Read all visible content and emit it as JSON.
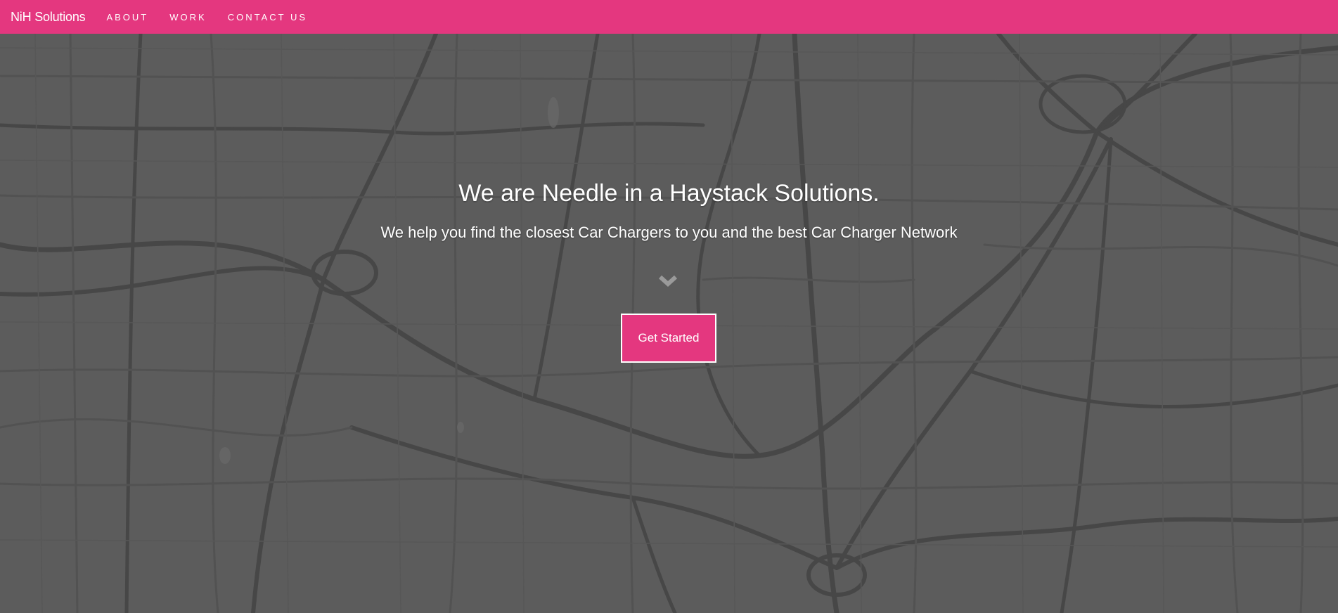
{
  "navbar": {
    "brand": "NiH Solutions",
    "links": [
      "ABOUT",
      "WORK",
      "CONTACT US"
    ],
    "background_color": "#e4377f"
  },
  "hero": {
    "title": "We are Needle in a Haystack Solutions.",
    "subtitle": "We help you find the closest Car Chargers to you and the best Car Charger Network",
    "scroll_icon": "chevron-down-icon",
    "cta_label": "Get Started",
    "cta_color": "#e4377f",
    "background": "grayscale road map"
  }
}
